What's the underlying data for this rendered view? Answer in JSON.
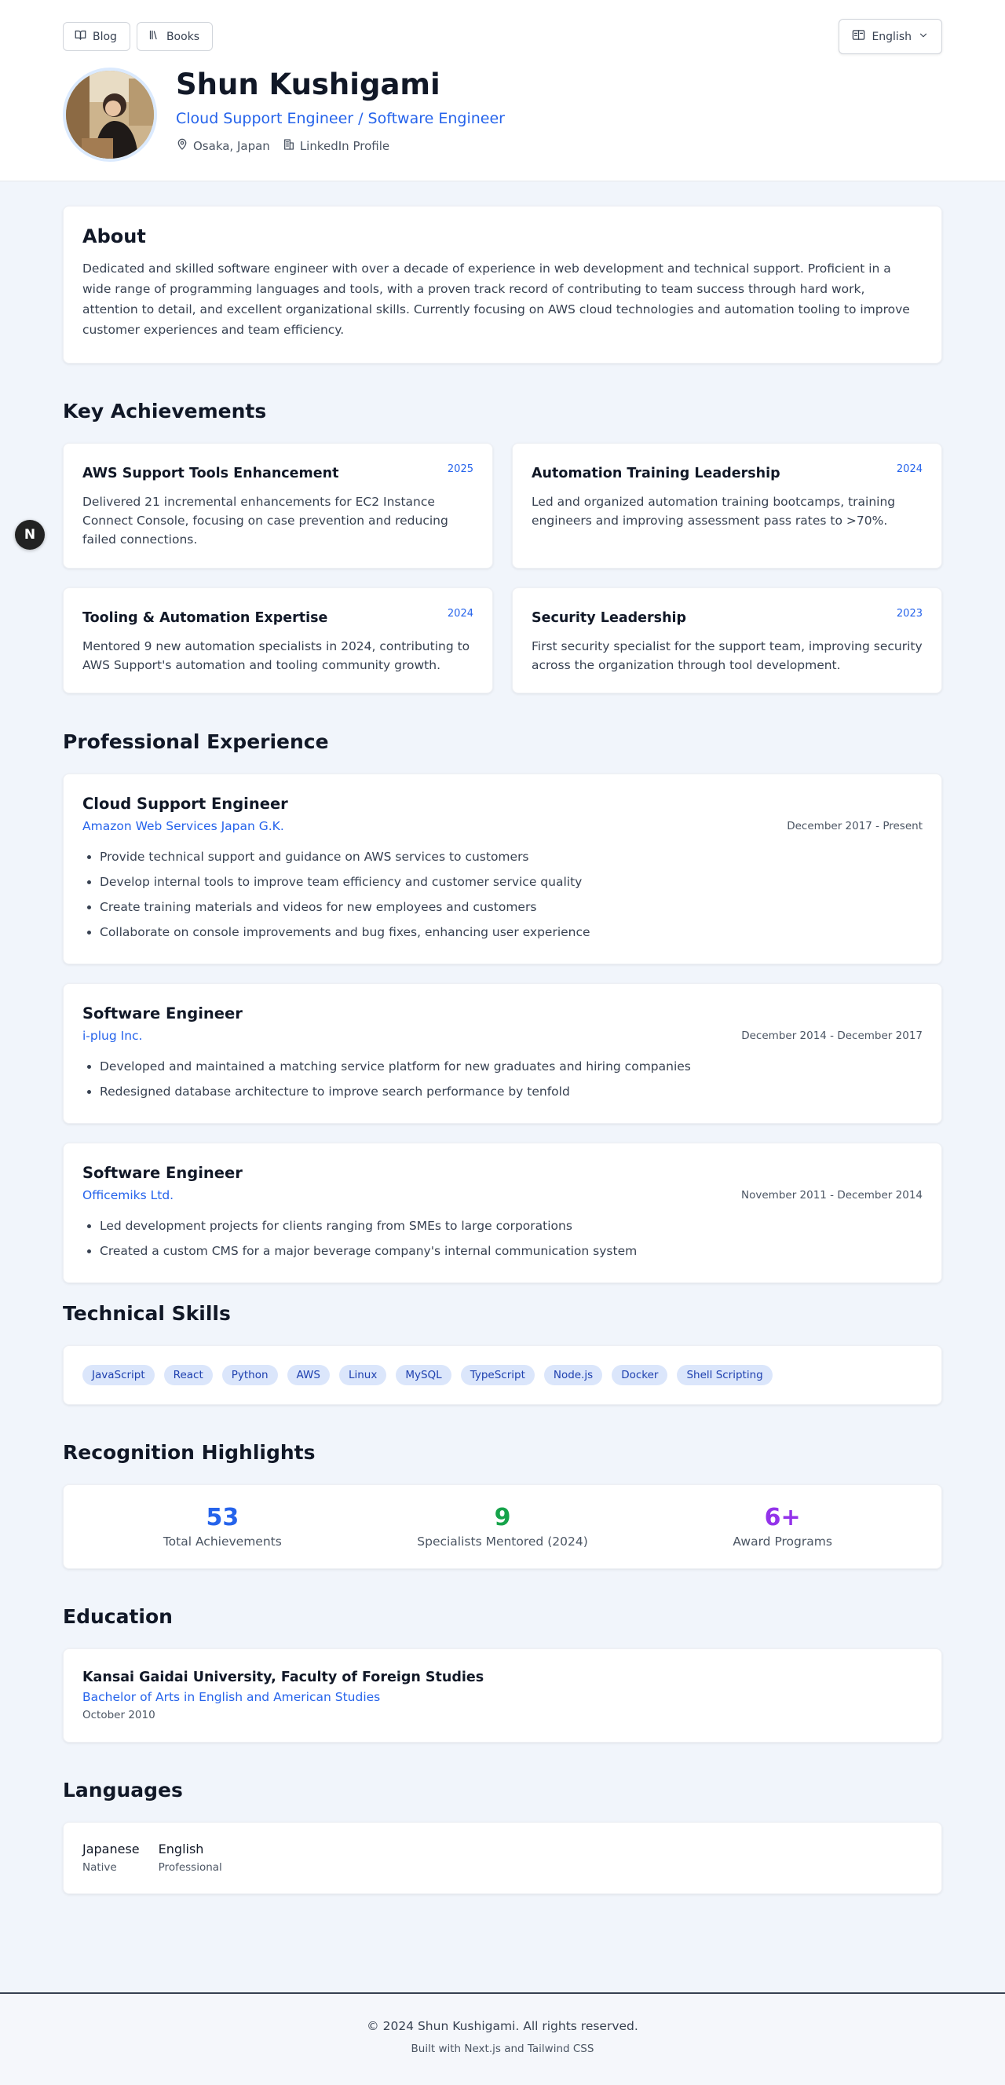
{
  "nav": {
    "blog_label": "Blog",
    "books_label": "Books",
    "language_label": "English"
  },
  "profile": {
    "name": "Shun Kushigami",
    "title": "Cloud Support Engineer / Software Engineer",
    "location": "Osaka, Japan",
    "linkedin_label": "LinkedIn Profile"
  },
  "about": {
    "heading": "About",
    "text": "Dedicated and skilled software engineer with over a decade of experience in web development and technical support. Proficient in a wide range of programming languages and tools, with a proven track record of contributing to team success through hard work, attention to detail, and excellent organizational skills. Currently focusing on AWS cloud technologies and automation tooling to improve customer experiences and team efficiency."
  },
  "achievements": {
    "heading": "Key Achievements",
    "items": [
      {
        "title": "AWS Support Tools Enhancement",
        "year": "2025",
        "text": "Delivered 21 incremental enhancements for EC2 Instance Connect Console, focusing on case prevention and reducing failed connections."
      },
      {
        "title": "Automation Training Leadership",
        "year": "2024",
        "text": "Led and organized automation training bootcamps, training engineers and improving assessment pass rates to >70%."
      },
      {
        "title": "Tooling & Automation Expertise",
        "year": "2024",
        "text": "Mentored 9 new automation specialists in 2024, contributing to AWS Support's automation and tooling community growth."
      },
      {
        "title": "Security Leadership",
        "year": "2023",
        "text": "First security specialist for the support team, improving security across the organization through tool development."
      }
    ]
  },
  "experience": {
    "heading": "Professional Experience",
    "jobs": [
      {
        "role": "Cloud Support Engineer",
        "company": "Amazon Web Services Japan G.K.",
        "dates": "December 2017 - Present",
        "bullets": [
          "Provide technical support and guidance on AWS services to customers",
          "Develop internal tools to improve team efficiency and customer service quality",
          "Create training materials and videos for new employees and customers",
          "Collaborate on console improvements and bug fixes, enhancing user experience"
        ]
      },
      {
        "role": "Software Engineer",
        "company": "i-plug Inc.",
        "dates": "December 2014 - December 2017",
        "bullets": [
          "Developed and maintained a matching service platform for new graduates and hiring companies",
          "Redesigned database architecture to improve search performance by tenfold"
        ]
      },
      {
        "role": "Software Engineer",
        "company": "Officemiks Ltd.",
        "dates": "November 2011 - December 2014",
        "bullets": [
          "Led development projects for clients ranging from SMEs to large corporations",
          "Created a custom CMS for a major beverage company's internal communication system"
        ]
      }
    ]
  },
  "skills": {
    "heading": "Technical Skills",
    "items": [
      "JavaScript",
      "React",
      "Python",
      "AWS",
      "Linux",
      "MySQL",
      "TypeScript",
      "Node.js",
      "Docker",
      "Shell Scripting"
    ]
  },
  "recognition": {
    "heading": "Recognition Highlights",
    "stats": [
      {
        "value": "53",
        "label": "Total Achievements",
        "color": "#2563eb"
      },
      {
        "value": "9",
        "label": "Specialists Mentored (2024)",
        "color": "#16a34a"
      },
      {
        "value": "6+",
        "label": "Award Programs",
        "color": "#9333ea"
      }
    ]
  },
  "education": {
    "heading": "Education",
    "school": "Kansai Gaidai University, Faculty of Foreign Studies",
    "degree": "Bachelor of Arts in English and American Studies",
    "date": "October 2010"
  },
  "languages": {
    "heading": "Languages",
    "items": [
      {
        "name": "Japanese",
        "level": "Native"
      },
      {
        "name": "English",
        "level": "Professional"
      }
    ]
  },
  "footer": {
    "copyright": "© 2024 Shun Kushigami. All rights reserved.",
    "built_with": "Built with Next.js and Tailwind CSS"
  },
  "fab_label": "N"
}
